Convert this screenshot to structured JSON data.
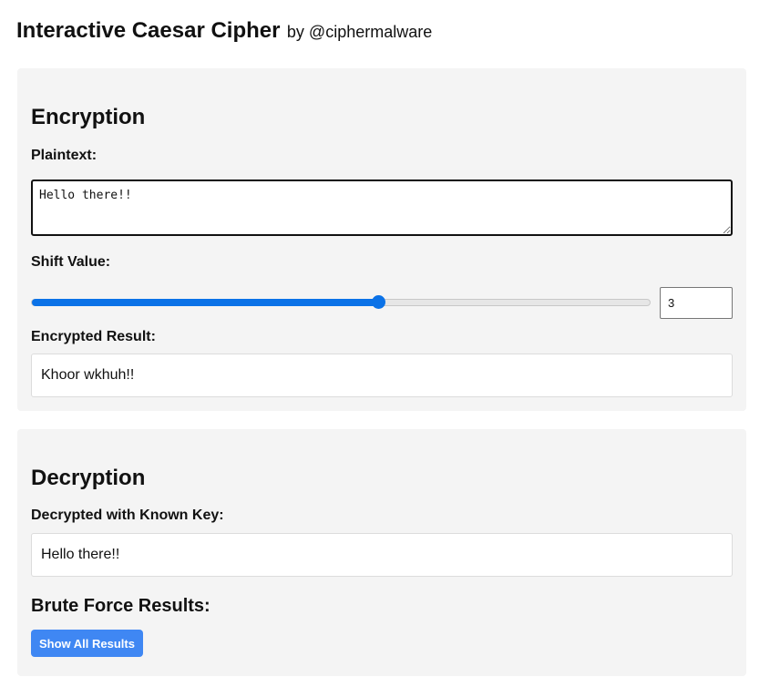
{
  "header": {
    "title": "Interactive Caesar Cipher",
    "byline": "by @ciphermalware"
  },
  "encryption": {
    "heading": "Encryption",
    "plaintext_label": "Plaintext:",
    "plaintext_value": "Hello there!!",
    "shift_label": "Shift Value:",
    "shift_value": "3",
    "shift_slider_fraction": 0.56,
    "result_label": "Encrypted Result:",
    "result_value": "Khoor wkhuh!!"
  },
  "decryption": {
    "heading": "Decryption",
    "known_key_label": "Decrypted with Known Key:",
    "known_key_result": "Hello there!!",
    "brute_force_heading": "Brute Force Results:",
    "show_all_label": "Show All Results"
  },
  "colors": {
    "accent": "#0b72e7",
    "button": "#3f87f3",
    "panel": "#f4f4f4"
  }
}
